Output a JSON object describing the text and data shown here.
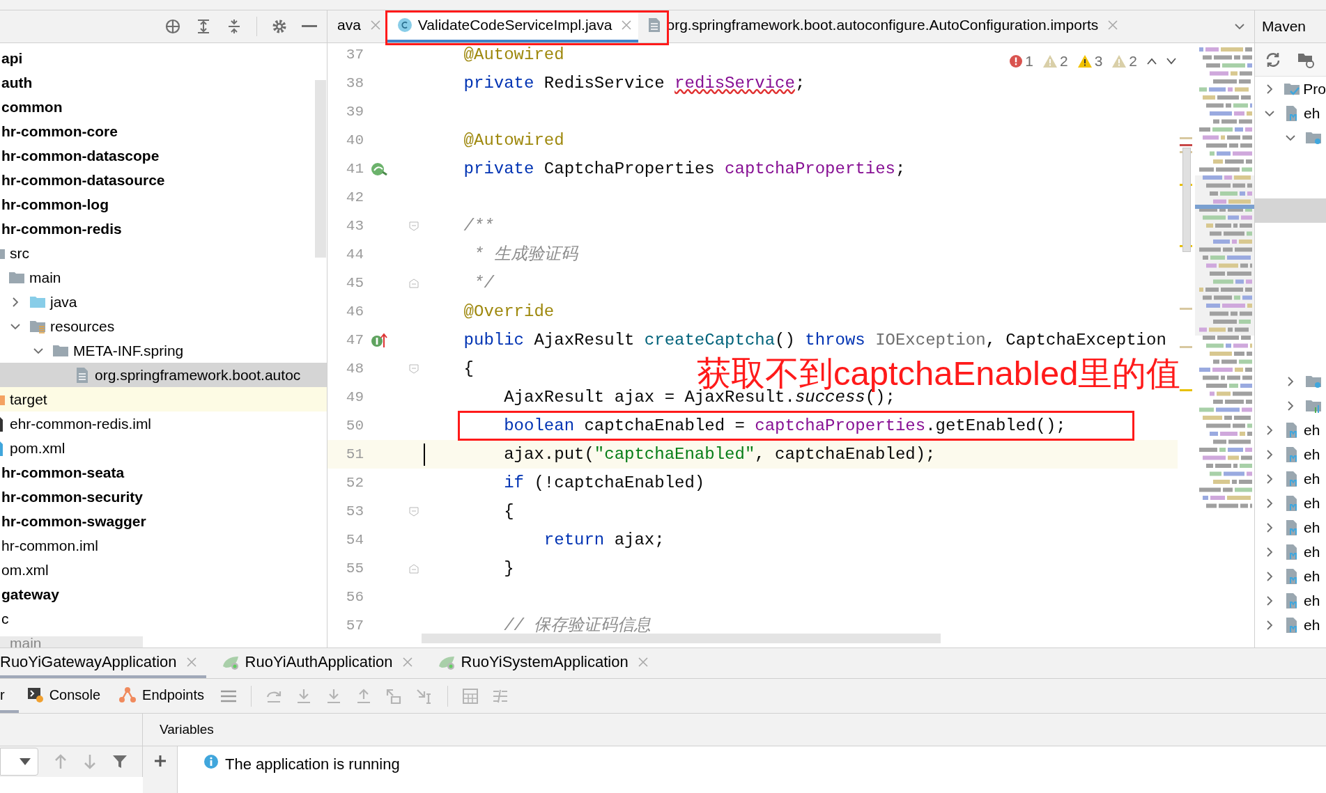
{
  "editor_tabs": [
    {
      "label": "ava",
      "kind": "plain",
      "selected": false
    },
    {
      "label": "ValidateCodeServiceImpl.java",
      "kind": "class",
      "selected": true
    },
    {
      "label": "org.springframework.boot.autoconfigure.AutoConfiguration.imports",
      "kind": "file",
      "selected": false
    }
  ],
  "project_tree": [
    {
      "label": "api",
      "kind": "module"
    },
    {
      "label": "auth",
      "kind": "module"
    },
    {
      "label": "common",
      "kind": "module",
      "children": [
        {
          "label": "hr-common-core",
          "kind": "module"
        },
        {
          "label": "hr-common-datascope",
          "kind": "module"
        },
        {
          "label": "hr-common-datasource",
          "kind": "module"
        },
        {
          "label": "hr-common-log",
          "kind": "module"
        },
        {
          "label": "hr-common-redis",
          "kind": "module",
          "children": [
            {
              "label": "src",
              "kind": "folder",
              "children": [
                {
                  "label": "main",
                  "kind": "folder",
                  "children": [
                    {
                      "label": "java",
                      "kind": "source",
                      "expanded": false
                    },
                    {
                      "label": "resources",
                      "kind": "resources",
                      "expanded": true,
                      "children": [
                        {
                          "label": "META-INF.spring",
                          "kind": "folder",
                          "expanded": true,
                          "children": [
                            {
                              "label": "org.springframework.boot.autoc",
                              "kind": "file",
                              "selected": true
                            }
                          ]
                        }
                      ]
                    }
                  ]
                }
              ]
            },
            {
              "label": "target",
              "kind": "excluded"
            },
            {
              "label": "ehr-common-redis.iml",
              "kind": "iml"
            },
            {
              "label": "pom.xml",
              "kind": "pom"
            }
          ]
        },
        {
          "label": "hr-common-seata",
          "kind": "module"
        },
        {
          "label": "hr-common-security",
          "kind": "module"
        },
        {
          "label": "hr-common-swagger",
          "kind": "module"
        },
        {
          "label": "hr-common.iml",
          "kind": "iml"
        },
        {
          "label": "om.xml",
          "kind": "pom"
        }
      ]
    },
    {
      "label": "gateway",
      "kind": "module",
      "children": [
        {
          "label": "c",
          "kind": "folder",
          "children": [
            {
              "label": "main",
              "kind": "folder"
            }
          ]
        }
      ]
    }
  ],
  "inspections": [
    {
      "kind": "error",
      "count": "1"
    },
    {
      "kind": "weak",
      "count": "2"
    },
    {
      "kind": "warning",
      "count": "3"
    },
    {
      "kind": "weak",
      "count": "2"
    }
  ],
  "code_lines": [
    {
      "number": "37",
      "kind": "plain",
      "current": false,
      "tokens": [
        {
          "kind": "annotation",
          "text": "    @Autowired"
        }
      ]
    },
    {
      "number": "38",
      "kind": "plain",
      "current": false,
      "tokens": [
        {
          "kind": "keyword",
          "text": "    private"
        },
        {
          "kind": "plain",
          "text": " RedisService "
        },
        {
          "kind": "field-warning",
          "text": "redisService"
        },
        {
          "kind": "plain",
          "text": ";"
        }
      ]
    },
    {
      "number": "39",
      "kind": "plain",
      "current": false
    },
    {
      "number": "40",
      "kind": "plain",
      "current": false,
      "tokens": [
        {
          "kind": "annotation",
          "text": "    @Autowired"
        }
      ]
    },
    {
      "number": "41",
      "kind": "bean",
      "current": false,
      "tokens": [
        {
          "kind": "keyword",
          "text": "    private"
        },
        {
          "kind": "plain",
          "text": " CaptchaProperties "
        },
        {
          "kind": "field",
          "text": "captchaProperties"
        },
        {
          "kind": "plain",
          "text": ";"
        }
      ]
    },
    {
      "number": "42",
      "kind": "plain",
      "current": false
    },
    {
      "number": "43",
      "kind": "fold-start",
      "current": false,
      "tokens": [
        {
          "kind": "comment",
          "text": "    /**"
        }
      ]
    },
    {
      "number": "44",
      "kind": "plain",
      "current": false,
      "tokens": [
        {
          "kind": "comment",
          "text": "     * 生成验证码"
        }
      ]
    },
    {
      "number": "45",
      "kind": "fold-end",
      "current": false,
      "tokens": [
        {
          "kind": "comment",
          "text": "     */"
        }
      ]
    },
    {
      "number": "46",
      "kind": "plain",
      "current": false,
      "tokens": [
        {
          "kind": "annotation",
          "text": "    @Override"
        }
      ]
    },
    {
      "number": "47",
      "kind": "override",
      "current": false,
      "tokens": [
        {
          "kind": "keyword",
          "text": "    public"
        },
        {
          "kind": "plain",
          "text": " AjaxResult "
        },
        {
          "kind": "method",
          "text": "createCaptcha"
        },
        {
          "kind": "plain",
          "text": "() "
        },
        {
          "kind": "keyword",
          "text": "throws"
        },
        {
          "kind": "unused",
          "text": " IOException"
        },
        {
          "kind": "plain",
          "text": ", CaptchaException"
        }
      ]
    },
    {
      "number": "48",
      "kind": "fold-start",
      "current": false,
      "tokens": [
        {
          "kind": "plain",
          "text": "    {"
        }
      ]
    },
    {
      "number": "49",
      "kind": "plain",
      "current": false,
      "tokens": [
        {
          "kind": "plain",
          "text": "        AjaxResult ajax = AjaxResult."
        },
        {
          "kind": "static",
          "text": "success"
        },
        {
          "kind": "plain",
          "text": "();"
        }
      ]
    },
    {
      "number": "50",
      "kind": "plain",
      "current": false,
      "boxed": true,
      "tokens": [
        {
          "kind": "keyword",
          "text": "        boolean"
        },
        {
          "kind": "plain",
          "text": " captchaEnabled = "
        },
        {
          "kind": "field",
          "text": "captchaProperties"
        },
        {
          "kind": "plain",
          "text": ".getEnabled();"
        }
      ]
    },
    {
      "number": "51",
      "kind": "plain",
      "current": true,
      "tokens": [
        {
          "kind": "plain",
          "text": "        ajax.put("
        },
        {
          "kind": "string",
          "text": "\"captchaEnabled\""
        },
        {
          "kind": "plain",
          "text": ", captchaEnabled);"
        }
      ]
    },
    {
      "number": "52",
      "kind": "plain",
      "current": false,
      "tokens": [
        {
          "kind": "keyword",
          "text": "        if"
        },
        {
          "kind": "plain",
          "text": " (!captchaEnabled)"
        }
      ]
    },
    {
      "number": "53",
      "kind": "fold-start",
      "current": false,
      "tokens": [
        {
          "kind": "plain",
          "text": "        {"
        }
      ]
    },
    {
      "number": "54",
      "kind": "plain",
      "current": false,
      "tokens": [
        {
          "kind": "keyword",
          "text": "            return"
        },
        {
          "kind": "plain",
          "text": " ajax;"
        }
      ]
    },
    {
      "number": "55",
      "kind": "fold-end",
      "current": false,
      "tokens": [
        {
          "kind": "plain",
          "text": "        }"
        }
      ]
    },
    {
      "number": "56",
      "kind": "plain",
      "current": false
    },
    {
      "number": "57",
      "kind": "plain",
      "current": false,
      "tokens": [
        {
          "kind": "comment",
          "text": "        // 保存验证码信息"
        }
      ]
    }
  ],
  "callout": {
    "text": "获取不到captchaEnabled里的值"
  },
  "maven": {
    "title": "Maven",
    "items": [
      {
        "label": "Pro",
        "kind": "projects",
        "expanded": false
      },
      {
        "label": "eh",
        "kind": "module",
        "expanded": true,
        "children": [
          {
            "kind": "lifecycle",
            "expanded": true
          },
          {
            "kind": "plugins",
            "expanded": false
          },
          {
            "kind": "dependencies",
            "expanded": false
          }
        ]
      },
      {
        "label": "eh",
        "kind": "module",
        "expanded": false
      },
      {
        "label": "eh",
        "kind": "module",
        "expanded": false
      },
      {
        "label": "eh",
        "kind": "module",
        "expanded": false
      },
      {
        "label": "eh",
        "kind": "module",
        "expanded": false
      },
      {
        "label": "eh",
        "kind": "module",
        "expanded": false
      },
      {
        "label": "eh",
        "kind": "module",
        "expanded": false
      },
      {
        "label": "eh",
        "kind": "module",
        "expanded": false
      },
      {
        "label": "eh",
        "kind": "module",
        "expanded": false
      },
      {
        "label": "eh",
        "kind": "module",
        "expanded": false
      }
    ]
  },
  "run_tabs": [
    {
      "label": "RuoYiGatewayApplication",
      "kind": "plain",
      "selected": true
    },
    {
      "label": "RuoYiAuthApplication",
      "kind": "spring",
      "selected": false
    },
    {
      "label": "RuoYiSystemApplication",
      "kind": "spring",
      "selected": false
    }
  ],
  "tool_tabs": [
    {
      "label": "r",
      "kind": "plain",
      "selected": true
    },
    {
      "label": "Console",
      "kind": "console",
      "selected": false
    },
    {
      "label": "Endpoints",
      "kind": "endpoints",
      "selected": false
    }
  ],
  "variables_header": "Variables",
  "console_message": "The application is running"
}
